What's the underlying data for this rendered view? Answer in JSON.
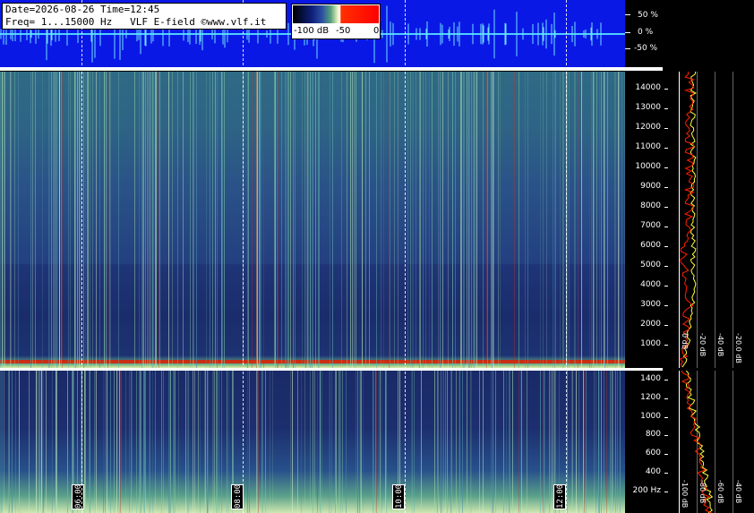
{
  "header": {
    "date_line": "Date=2026-08-26 Time=12:45",
    "freq_line": "Freq= 1...15000 Hz   VLF E-field ©www.vlf.it"
  },
  "legend": {
    "minus100": "-100 dB",
    "minus50": "-50",
    "zero": "0"
  },
  "wave_scale": [
    "50 %",
    "0 %",
    "-50 %"
  ],
  "upper_freq_labels": [
    "14000",
    "13000",
    "12000",
    "11000",
    "10000",
    "9000",
    "8000",
    "7000",
    "6000",
    "5000",
    "4000",
    "3000",
    "2000",
    "1000"
  ],
  "lower_freq_labels": [
    "1400",
    "1200",
    "1000",
    "800",
    "600",
    "400",
    "200 Hz"
  ],
  "db_labels": [
    "0 dB",
    "-20 dB",
    "-40 dB",
    "-20.0 dB"
  ],
  "lower_db_labels": [
    "-100 dB",
    "-80 dB",
    "-60 dB",
    "-40 dB"
  ],
  "time_labels": [
    "06:00",
    "08:00",
    "10:00",
    "12:00"
  ],
  "colors": {
    "wave_bg": "#0a18e6",
    "spec_bg": "#182a6b",
    "trace_red": "#ff2000",
    "trace_yellow": "#ffff40"
  }
}
